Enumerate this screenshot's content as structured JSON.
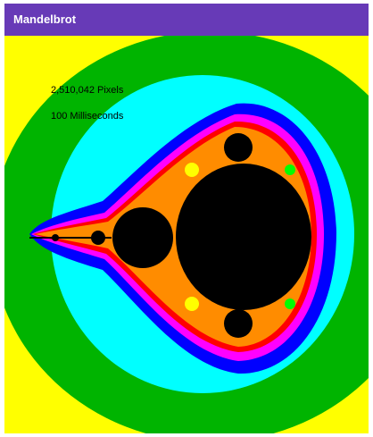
{
  "window": {
    "title": "Mandelbrot"
  },
  "stats": {
    "pixels_label": "2,510,042 Pixels",
    "time_label": "100 Milliseconds"
  },
  "colors": {
    "title_bar": "#673ab7",
    "title_text": "#ffffff",
    "escape_bands": [
      "#ffff00",
      "#00b400",
      "#00ffff",
      "#0000ff",
      "#ff00ff",
      "#ff0000",
      "#ff8c00",
      "#000000"
    ]
  }
}
